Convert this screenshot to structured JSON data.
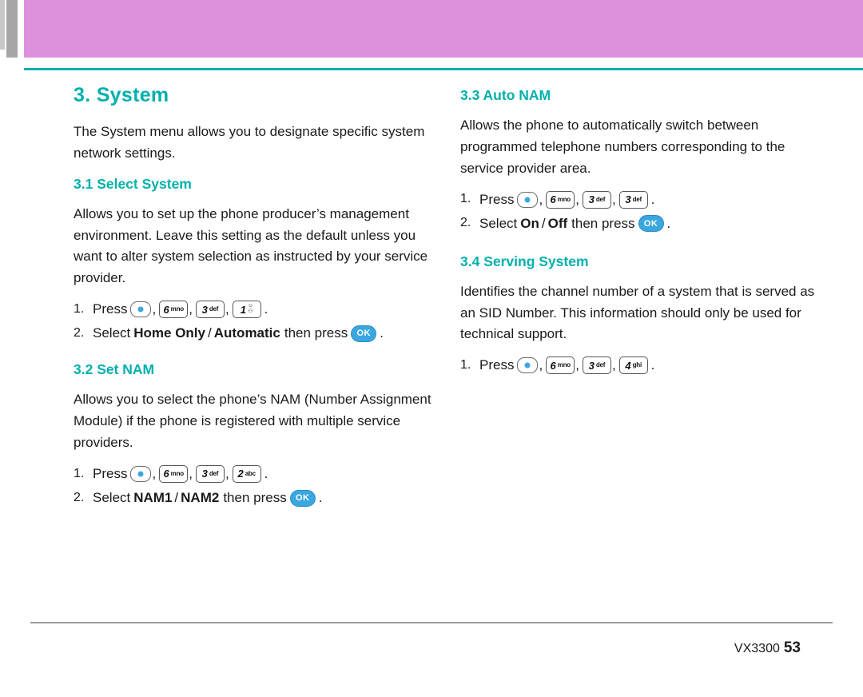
{
  "header": {
    "band_color": "#dd91dd",
    "rule_color": "#00b0ad"
  },
  "left_column": {
    "chapter_title": "3. System",
    "intro": "The System menu allows you to designate specific system network settings.",
    "sections": [
      {
        "title": "3.1 Select System",
        "body": "Allows you to set up the phone producer’s management environment. Leave this setting as the default unless you want to alter system selection as instructed by your service provider.",
        "steps": [
          {
            "num": "1.",
            "label": "Press",
            "keys": [
              "menu-key",
              "6mno",
              "3def",
              "1"
            ]
          },
          {
            "num": "2.",
            "label": "Select",
            "option_a": "Home Only",
            "separator": "/",
            "option_b": "Automatic",
            "label2": "then press",
            "keys": [
              "ok-key"
            ]
          }
        ]
      },
      {
        "title": "3.2 Set NAM",
        "body": "Allows you to select the phone’s NAM (Number Assignment Module) if the phone is registered with multiple service providers.",
        "steps": [
          {
            "num": "1.",
            "label": "Press",
            "keys": [
              "menu-key",
              "6mno",
              "3def",
              "2abc"
            ]
          },
          {
            "num": "2.",
            "label": "Select",
            "option_a": "NAM1",
            "separator": "/",
            "option_b": "NAM2",
            "label2": "then press",
            "keys": [
              "ok-key"
            ]
          }
        ]
      }
    ]
  },
  "right_column": {
    "sections": [
      {
        "title": "3.3 Auto NAM",
        "body": "Allows the phone to automatically switch between programmed telephone numbers corresponding to the service provider area.",
        "steps": [
          {
            "num": "1.",
            "label": "Press",
            "keys": [
              "menu-key",
              "6mno",
              "3def",
              "3def"
            ]
          },
          {
            "num": "2.",
            "label": "Select",
            "option_a": "On",
            "separator": "/",
            "option_b": "Off",
            "label2": "then press",
            "keys": [
              "ok-key"
            ]
          }
        ]
      },
      {
        "title": "3.4 Serving System",
        "body": "Identifies the channel number of a system that is served as an SID Number. This information should only be used for technical support.",
        "steps": [
          {
            "num": "1.",
            "label": "Press",
            "keys": [
              "menu-key",
              "6mno",
              "3def",
              "4ghi"
            ]
          }
        ]
      }
    ]
  },
  "keys": {
    "k1": {
      "digit": "1",
      "sub_top": "☺",
      "sub_bottom": "⚇"
    },
    "k2": {
      "digit": "2",
      "letters": "abc"
    },
    "k3": {
      "digit": "3",
      "letters": "def"
    },
    "k4": {
      "digit": "4",
      "letters": "ghi"
    },
    "k6": {
      "digit": "6",
      "letters": "mno"
    },
    "ok": {
      "label": "OK"
    }
  },
  "footer": {
    "model": "VX3300",
    "page_number": "53"
  },
  "punctuation": {
    "comma": ",",
    "period": ".",
    "slash": "/"
  }
}
